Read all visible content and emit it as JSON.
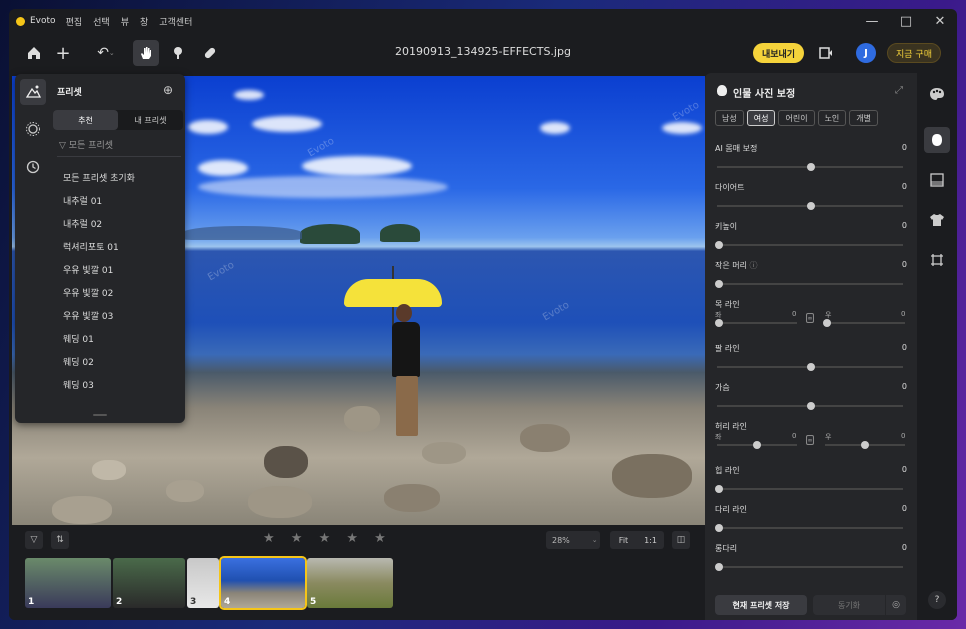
{
  "app": {
    "name": "Evoto",
    "menus": [
      "편집",
      "선택",
      "뷰",
      "창",
      "고객센터"
    ]
  },
  "toolbar": {
    "filename": "20190913_134925-EFFECTS.jpg",
    "export_label": "내보내기",
    "avatar_initial": "J",
    "buy_label": "지금 구매"
  },
  "presets": {
    "title": "프리셋",
    "tabs": [
      "추천",
      "내 프리셋"
    ],
    "filter_label": "모든 프리셋",
    "items": [
      "모든 프리셋 초기화",
      "내추럴 01",
      "내추럴 02",
      "럭셔리포토 01",
      "우유 빛깔 01",
      "우유 빛깔 02",
      "우유 빛깔 03",
      "웨딩 01",
      "웨딩 02",
      "웨딩 03"
    ]
  },
  "bottom": {
    "zoom": "28%",
    "fit": "Fit",
    "one_to_one": "1:1",
    "stars": "★ ★ ★ ★ ★",
    "thumb_numbers": [
      "1",
      "2",
      "3",
      "4",
      "5"
    ]
  },
  "portrait": {
    "title": "인물 사진 보정",
    "genders": [
      "남성",
      "여성",
      "어린이",
      "노인",
      "개별"
    ],
    "sliders": [
      {
        "label": "AI 몸매 보정",
        "value": "0"
      },
      {
        "label": "다이어트",
        "value": "0"
      },
      {
        "label": "키높이",
        "value": "0"
      },
      {
        "label": "작은 머리",
        "value": "0"
      },
      {
        "label": "목 라인",
        "left_label": "좌",
        "left_value": "0",
        "right_label": "우",
        "right_value": "0"
      },
      {
        "label": "팔 라인",
        "value": "0"
      },
      {
        "label": "가슴",
        "value": "0"
      },
      {
        "label": "허리 라인",
        "left_label": "좌",
        "left_value": "0",
        "right_label": "우",
        "right_value": "0"
      },
      {
        "label": "힙 라인",
        "value": "0"
      },
      {
        "label": "다리 라인",
        "value": "0"
      },
      {
        "label": "롱다리",
        "value": "0"
      }
    ],
    "save_preset": "현재 프리셋 저장",
    "sync": "동기화"
  },
  "help": "?"
}
